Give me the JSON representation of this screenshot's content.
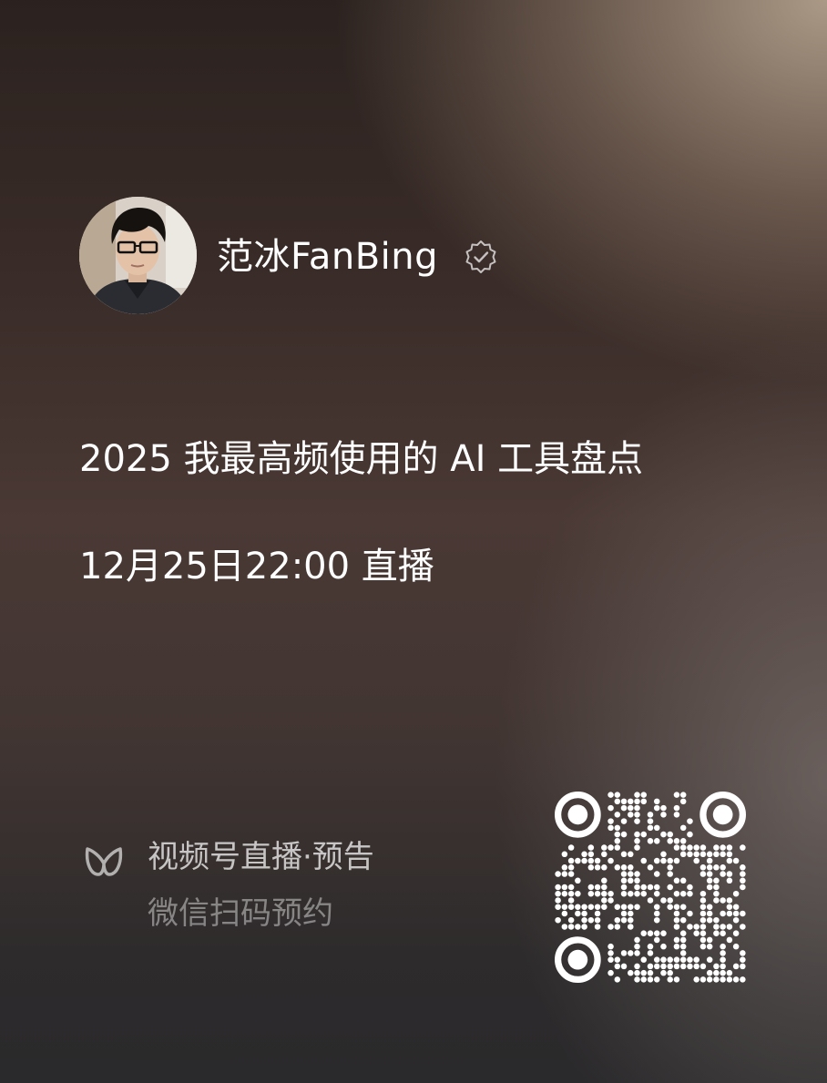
{
  "author": {
    "name": "范冰FanBing",
    "avatar_icon": "person-avatar",
    "badge_icon": "verified-badge-icon"
  },
  "live": {
    "title": "2025 我最高频使用的 AI 工具盘点",
    "schedule": "12月25日22:00 直播"
  },
  "footer": {
    "channel_icon": "wechat-channels-icon",
    "channel_label": "视频号直播·预告",
    "scan_hint": "微信扫码预约",
    "qr_icon": "qr-code"
  },
  "colors": {
    "text_primary": "#ffffff",
    "background_dark": "#2b221f",
    "background_light": "#b2a08c"
  }
}
